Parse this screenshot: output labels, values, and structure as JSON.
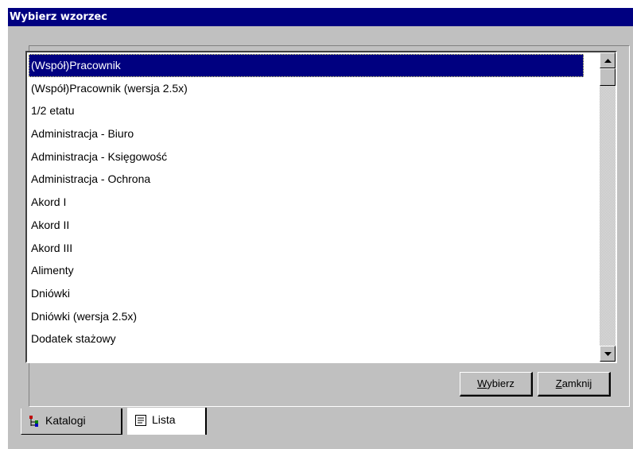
{
  "window": {
    "title": "Wybierz wzorzec"
  },
  "list": {
    "items": [
      "(Współ)Pracownik",
      "(Współ)Pracownik (wersja 2.5x)",
      "1/2 etatu",
      "Administracja - Biuro",
      "Administracja - Księgowość",
      "Administracja - Ochrona",
      "Akord I",
      "Akord II",
      "Akord III",
      "Alimenty",
      "Dniówki",
      "Dniówki (wersja 2.5x)",
      "Dodatek stażowy"
    ],
    "selected_index": 0
  },
  "buttons": {
    "wybierz": {
      "accel": "W",
      "rest": "ybierz"
    },
    "zamknij": {
      "accel": "Z",
      "rest": "amknij"
    }
  },
  "tabs": [
    {
      "label": "Katalogi",
      "icon": "tree-icon",
      "active": false
    },
    {
      "label": "Lista",
      "icon": "list-icon",
      "active": true
    }
  ],
  "colors": {
    "titlebar": "#000080",
    "selection": "#000080",
    "face": "#c0c0c0"
  }
}
